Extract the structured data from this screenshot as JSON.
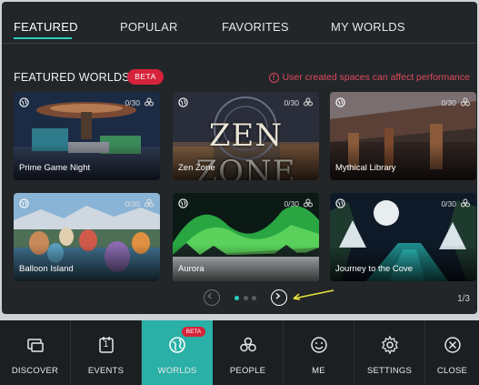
{
  "tabs": [
    {
      "label": "FEATURED",
      "active": true
    },
    {
      "label": "POPULAR",
      "active": false
    },
    {
      "label": "FAVORITES",
      "active": false
    },
    {
      "label": "MY WORLDS",
      "active": false
    }
  ],
  "section": {
    "title": "FEATURED WORLDS",
    "badge": "BETA",
    "warning": "User created spaces can affect performance",
    "warning_icon": "exclamation-circle-icon"
  },
  "worlds": [
    {
      "name": "Prime Game Night",
      "count": "0/30"
    },
    {
      "name": "Zen Zone",
      "count": "0/30",
      "banner": "ZEN ZONE"
    },
    {
      "name": "Mythical Library",
      "count": "0/30"
    },
    {
      "name": "Balloon Island",
      "count": "0/30"
    },
    {
      "name": "Aurora",
      "count": "0/30"
    },
    {
      "name": "Journey to the Cove",
      "count": "0/30"
    }
  ],
  "pagination": {
    "page": "1/3",
    "current_dot": 1,
    "total_dots": 3
  },
  "nav": [
    {
      "label": "DISCOVER",
      "icon": "discover-icon",
      "active": false
    },
    {
      "label": "EVENTS",
      "icon": "calendar-icon",
      "active": false,
      "icon_text": "1"
    },
    {
      "label": "WORLDS",
      "icon": "globe-icon",
      "active": true,
      "badge": "BETA"
    },
    {
      "label": "PEOPLE",
      "icon": "people-icon",
      "active": false
    },
    {
      "label": "ME",
      "icon": "smiley-icon",
      "active": false
    },
    {
      "label": "SETTINGS",
      "icon": "gear-icon",
      "active": false
    },
    {
      "label": "CLOSE",
      "icon": "close-icon",
      "active": false
    }
  ],
  "colors": {
    "accent": "#2ab0a6",
    "tab_underline": "#2ad0c0",
    "badge": "#d6233c",
    "warning": "#e0495a",
    "annotation_arrow": "#e8e23a"
  }
}
